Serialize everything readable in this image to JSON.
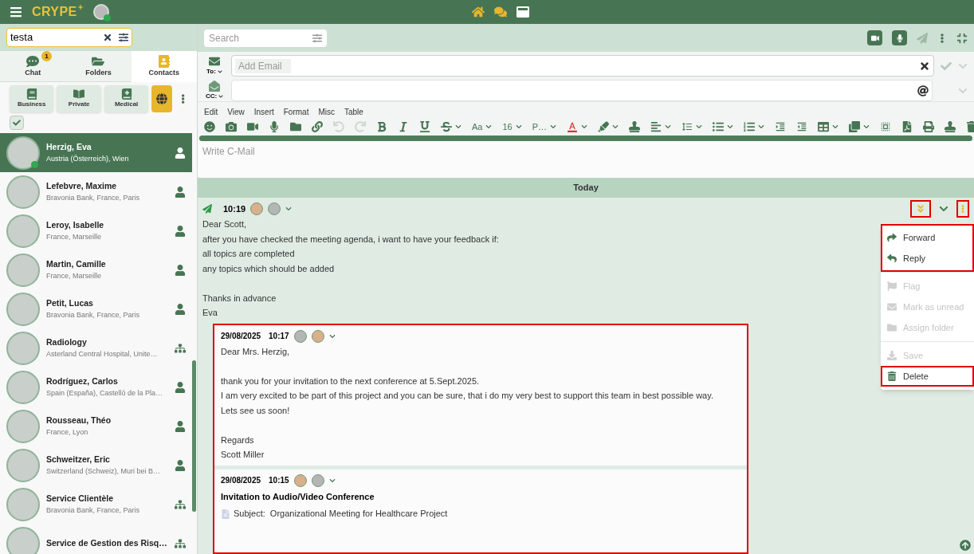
{
  "app": {
    "logo": "CRYPE"
  },
  "sidebar": {
    "search": {
      "value": "testa"
    },
    "tabs": [
      {
        "label": "Chat",
        "badge": "1",
        "selected": false
      },
      {
        "label": "Folders",
        "selected": false
      },
      {
        "label": "Contacts",
        "selected": true
      }
    ],
    "filters": [
      {
        "label": "Business",
        "kind": "book",
        "selected": false
      },
      {
        "label": "Private",
        "kind": "book",
        "selected": false
      },
      {
        "label": "Medical",
        "kind": "book",
        "selected": false
      },
      {
        "kind": "globe",
        "selected": true
      }
    ],
    "select_all": {
      "checked": true
    },
    "contacts": [
      {
        "name": "Herzig, Eva",
        "detail": "Austria (Österreich), Wien",
        "kind": "person",
        "selected": true,
        "online": true
      },
      {
        "name": "Lefebvre, Maxime",
        "detail": "Bravonia Bank, France, Paris",
        "kind": "person",
        "selected": false,
        "online": false
      },
      {
        "name": "Leroy, Isabelle",
        "detail": "France, Marseille",
        "kind": "person",
        "selected": false,
        "online": false
      },
      {
        "name": "Martin, Camille",
        "detail": "France, Marseille",
        "kind": "person",
        "selected": false,
        "online": false
      },
      {
        "name": "Petit, Lucas",
        "detail": "Bravonia Bank, France, Paris",
        "kind": "person",
        "selected": false,
        "online": false
      },
      {
        "name": "Radiology",
        "detail": "Asterland Central Hospital, Unite…",
        "kind": "group",
        "selected": false,
        "online": false
      },
      {
        "name": "Rodríguez, Carlos",
        "detail": "Spain (España), Castelló de la Pla…",
        "kind": "person",
        "selected": false,
        "online": false
      },
      {
        "name": "Rousseau, Théo",
        "detail": "France, Lyon",
        "kind": "person",
        "selected": false,
        "online": false
      },
      {
        "name": "Schweitzer, Eric",
        "detail": "Switzerland (Schweiz), Muri bei B…",
        "kind": "person",
        "selected": false,
        "online": false
      },
      {
        "name": "Service Clientèle",
        "detail": "Bravonia Bank, France, Paris",
        "kind": "group",
        "selected": false,
        "online": false
      },
      {
        "name": "Service de Gestion des Risq…",
        "kind": "group",
        "selected": false,
        "online": false
      }
    ]
  },
  "composer": {
    "search": {
      "placeholder": "Search"
    },
    "to": {
      "label": "To:",
      "placeholder": "Add Email"
    },
    "cc": {
      "label": "CC:"
    },
    "menu": [
      "Edit",
      "View",
      "Insert",
      "Format",
      "Misc",
      "Table"
    ],
    "toolbar": {
      "text_style": "Aa",
      "font_size": "16",
      "font_family": "P…",
      "undo": {
        "disabled": true
      },
      "redo": {
        "disabled": true
      }
    },
    "body": {
      "placeholder": "Write C-Mail"
    }
  },
  "thread": {
    "day": "Today",
    "message": {
      "time": "10:19",
      "paragraphs": [
        [
          "Dear Scott,",
          "after you have checked the meeting agenda, i want to have your feedback if:",
          "all topics are completed",
          "any topics which should be added"
        ],
        [
          "Thanks in advance",
          "Eva"
        ]
      ],
      "highlighted_actions": true
    },
    "quoted": {
      "highlighted": true,
      "replies": [
        {
          "date": "29/08/2025",
          "time": "10:17",
          "paragraphs": [
            [
              "Dear Mrs. Herzig,"
            ],
            [
              "thank you for your invitation to the next conference at 5.Sept.2025.",
              "I am very excited to be part of this project and you can be sure, that i do my very best to support this team in best possible way.",
              "Lets see us soon!"
            ],
            [
              "Regards",
              "Scott Miller"
            ]
          ]
        },
        {
          "date": "29/08/2025",
          "time": "10:15",
          "title": "Invitation to Audio/Video Conference",
          "subject": "Subject:  Organizational Meeting for Healthcare Project"
        }
      ]
    }
  },
  "context_menu": {
    "groups": [
      {
        "highlighted": true,
        "items": [
          {
            "label": "Forward",
            "kind": "forward",
            "disabled": false,
            "highlighted": false
          },
          {
            "label": "Reply",
            "kind": "reply",
            "disabled": false,
            "highlighted": false
          }
        ]
      },
      {
        "highlighted": false,
        "items": [
          {
            "label": "Flag",
            "kind": "flag",
            "disabled": true,
            "highlighted": false
          },
          {
            "label": "Mark as unread",
            "kind": "unread",
            "disabled": true,
            "highlighted": false
          },
          {
            "label": "Assign folder",
            "kind": "folder",
            "disabled": true,
            "highlighted": false
          }
        ]
      },
      {
        "highlighted": false,
        "items": [
          {
            "label": "Save",
            "kind": "save",
            "disabled": true,
            "highlighted": false
          },
          {
            "label": "Delete",
            "kind": "delete",
            "disabled": false,
            "highlighted": true
          }
        ]
      }
    ]
  }
}
